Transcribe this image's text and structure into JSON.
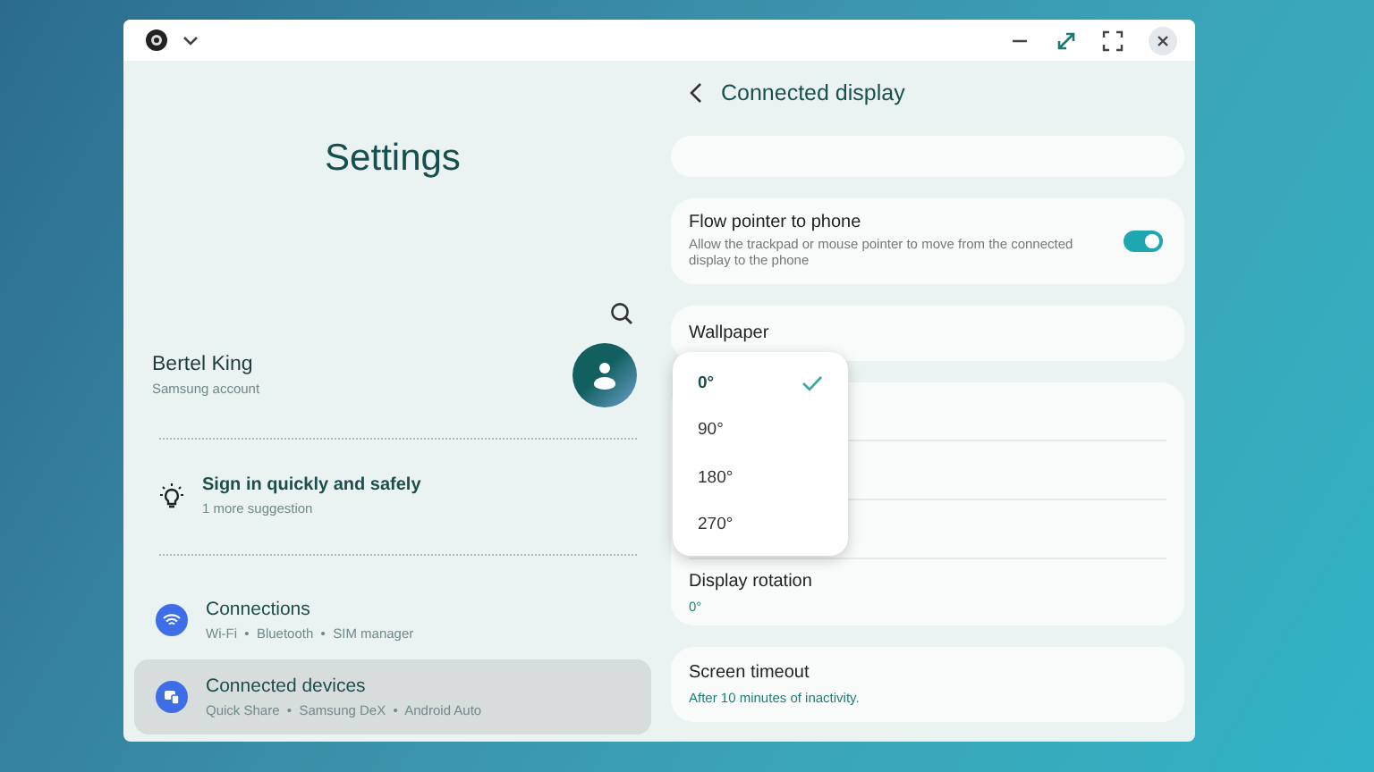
{
  "settings": {
    "title": "Settings",
    "profile": {
      "name": "Bertel King",
      "subtitle": "Samsung account"
    },
    "suggestion": {
      "title": "Sign in quickly and safely",
      "subtitle": "1 more suggestion"
    },
    "items": [
      {
        "kind": "wifi",
        "title": "Connections",
        "subtitle": "Wi-Fi  •  Bluetooth  •  SIM manager",
        "selected": false
      },
      {
        "kind": "devices",
        "title": "Connected devices",
        "subtitle": "Quick Share  •  Samsung DeX  •  Android Auto",
        "selected": true
      }
    ]
  },
  "detail": {
    "title": "Connected display",
    "flow_pointer": {
      "title": "Flow pointer to phone",
      "description": "Allow the trackpad or mouse pointer to move from the connected display to the phone",
      "on": true
    },
    "wallpaper": {
      "title": "Wallpaper"
    },
    "display_rotation": {
      "title": "Display rotation",
      "value": "0°"
    },
    "screen_timeout": {
      "title": "Screen timeout",
      "value": "After 10 minutes of inactivity."
    },
    "rotation_menu": [
      {
        "label": "0°",
        "selected": true
      },
      {
        "label": "90°",
        "selected": false
      },
      {
        "label": "180°",
        "selected": false
      },
      {
        "label": "270°",
        "selected": false
      }
    ]
  }
}
